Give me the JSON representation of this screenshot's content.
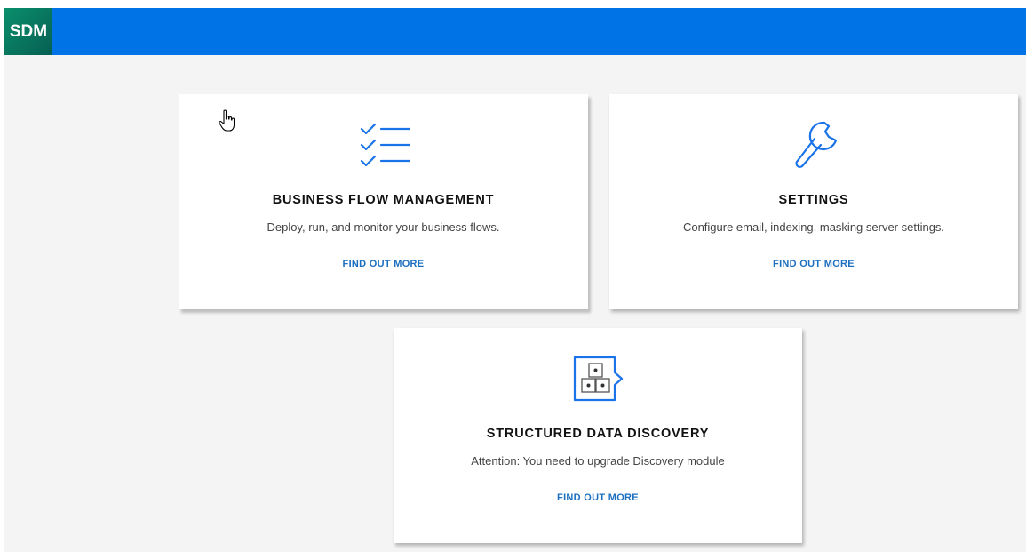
{
  "header": {
    "logo_text": "SDM",
    "bar_color": "#0073e7",
    "logo_color": "#077a5f"
  },
  "cards": [
    {
      "icon": "checklist-icon",
      "title": "BUSINESS FLOW MANAGEMENT",
      "description": "Deploy, run, and monitor your business flows.",
      "link": "FIND OUT MORE"
    },
    {
      "icon": "wrench-icon",
      "title": "SETTINGS",
      "description": "Configure email, indexing, masking server settings.",
      "link": "FIND OUT MORE"
    },
    {
      "icon": "data-discovery-icon",
      "title": "STRUCTURED DATA DISCOVERY",
      "description": "Attention: You need to upgrade Discovery module",
      "link": "FIND OUT MORE"
    }
  ],
  "accent_color": "#1a73e8",
  "link_color": "#1d6fc0"
}
